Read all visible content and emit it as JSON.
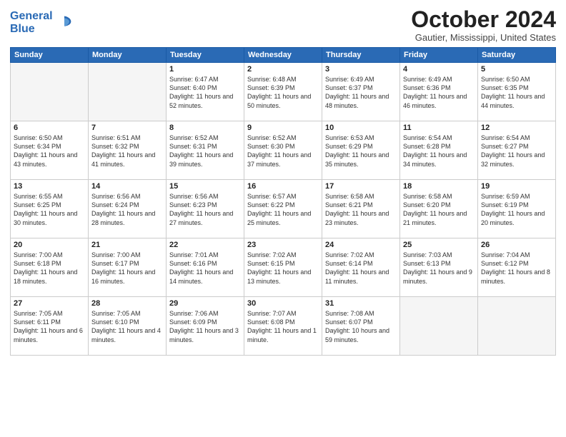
{
  "logo": {
    "line1": "General",
    "line2": "Blue"
  },
  "title": "October 2024",
  "location": "Gautier, Mississippi, United States",
  "days_of_week": [
    "Sunday",
    "Monday",
    "Tuesday",
    "Wednesday",
    "Thursday",
    "Friday",
    "Saturday"
  ],
  "weeks": [
    [
      {
        "day": "",
        "info": ""
      },
      {
        "day": "",
        "info": ""
      },
      {
        "day": "1",
        "info": "Sunrise: 6:47 AM\nSunset: 6:40 PM\nDaylight: 11 hours and 52 minutes."
      },
      {
        "day": "2",
        "info": "Sunrise: 6:48 AM\nSunset: 6:39 PM\nDaylight: 11 hours and 50 minutes."
      },
      {
        "day": "3",
        "info": "Sunrise: 6:49 AM\nSunset: 6:37 PM\nDaylight: 11 hours and 48 minutes."
      },
      {
        "day": "4",
        "info": "Sunrise: 6:49 AM\nSunset: 6:36 PM\nDaylight: 11 hours and 46 minutes."
      },
      {
        "day": "5",
        "info": "Sunrise: 6:50 AM\nSunset: 6:35 PM\nDaylight: 11 hours and 44 minutes."
      }
    ],
    [
      {
        "day": "6",
        "info": "Sunrise: 6:50 AM\nSunset: 6:34 PM\nDaylight: 11 hours and 43 minutes."
      },
      {
        "day": "7",
        "info": "Sunrise: 6:51 AM\nSunset: 6:32 PM\nDaylight: 11 hours and 41 minutes."
      },
      {
        "day": "8",
        "info": "Sunrise: 6:52 AM\nSunset: 6:31 PM\nDaylight: 11 hours and 39 minutes."
      },
      {
        "day": "9",
        "info": "Sunrise: 6:52 AM\nSunset: 6:30 PM\nDaylight: 11 hours and 37 minutes."
      },
      {
        "day": "10",
        "info": "Sunrise: 6:53 AM\nSunset: 6:29 PM\nDaylight: 11 hours and 35 minutes."
      },
      {
        "day": "11",
        "info": "Sunrise: 6:54 AM\nSunset: 6:28 PM\nDaylight: 11 hours and 34 minutes."
      },
      {
        "day": "12",
        "info": "Sunrise: 6:54 AM\nSunset: 6:27 PM\nDaylight: 11 hours and 32 minutes."
      }
    ],
    [
      {
        "day": "13",
        "info": "Sunrise: 6:55 AM\nSunset: 6:25 PM\nDaylight: 11 hours and 30 minutes."
      },
      {
        "day": "14",
        "info": "Sunrise: 6:56 AM\nSunset: 6:24 PM\nDaylight: 11 hours and 28 minutes."
      },
      {
        "day": "15",
        "info": "Sunrise: 6:56 AM\nSunset: 6:23 PM\nDaylight: 11 hours and 27 minutes."
      },
      {
        "day": "16",
        "info": "Sunrise: 6:57 AM\nSunset: 6:22 PM\nDaylight: 11 hours and 25 minutes."
      },
      {
        "day": "17",
        "info": "Sunrise: 6:58 AM\nSunset: 6:21 PM\nDaylight: 11 hours and 23 minutes."
      },
      {
        "day": "18",
        "info": "Sunrise: 6:58 AM\nSunset: 6:20 PM\nDaylight: 11 hours and 21 minutes."
      },
      {
        "day": "19",
        "info": "Sunrise: 6:59 AM\nSunset: 6:19 PM\nDaylight: 11 hours and 20 minutes."
      }
    ],
    [
      {
        "day": "20",
        "info": "Sunrise: 7:00 AM\nSunset: 6:18 PM\nDaylight: 11 hours and 18 minutes."
      },
      {
        "day": "21",
        "info": "Sunrise: 7:00 AM\nSunset: 6:17 PM\nDaylight: 11 hours and 16 minutes."
      },
      {
        "day": "22",
        "info": "Sunrise: 7:01 AM\nSunset: 6:16 PM\nDaylight: 11 hours and 14 minutes."
      },
      {
        "day": "23",
        "info": "Sunrise: 7:02 AM\nSunset: 6:15 PM\nDaylight: 11 hours and 13 minutes."
      },
      {
        "day": "24",
        "info": "Sunrise: 7:02 AM\nSunset: 6:14 PM\nDaylight: 11 hours and 11 minutes."
      },
      {
        "day": "25",
        "info": "Sunrise: 7:03 AM\nSunset: 6:13 PM\nDaylight: 11 hours and 9 minutes."
      },
      {
        "day": "26",
        "info": "Sunrise: 7:04 AM\nSunset: 6:12 PM\nDaylight: 11 hours and 8 minutes."
      }
    ],
    [
      {
        "day": "27",
        "info": "Sunrise: 7:05 AM\nSunset: 6:11 PM\nDaylight: 11 hours and 6 minutes."
      },
      {
        "day": "28",
        "info": "Sunrise: 7:05 AM\nSunset: 6:10 PM\nDaylight: 11 hours and 4 minutes."
      },
      {
        "day": "29",
        "info": "Sunrise: 7:06 AM\nSunset: 6:09 PM\nDaylight: 11 hours and 3 minutes."
      },
      {
        "day": "30",
        "info": "Sunrise: 7:07 AM\nSunset: 6:08 PM\nDaylight: 11 hours and 1 minute."
      },
      {
        "day": "31",
        "info": "Sunrise: 7:08 AM\nSunset: 6:07 PM\nDaylight: 10 hours and 59 minutes."
      },
      {
        "day": "",
        "info": ""
      },
      {
        "day": "",
        "info": ""
      }
    ]
  ]
}
